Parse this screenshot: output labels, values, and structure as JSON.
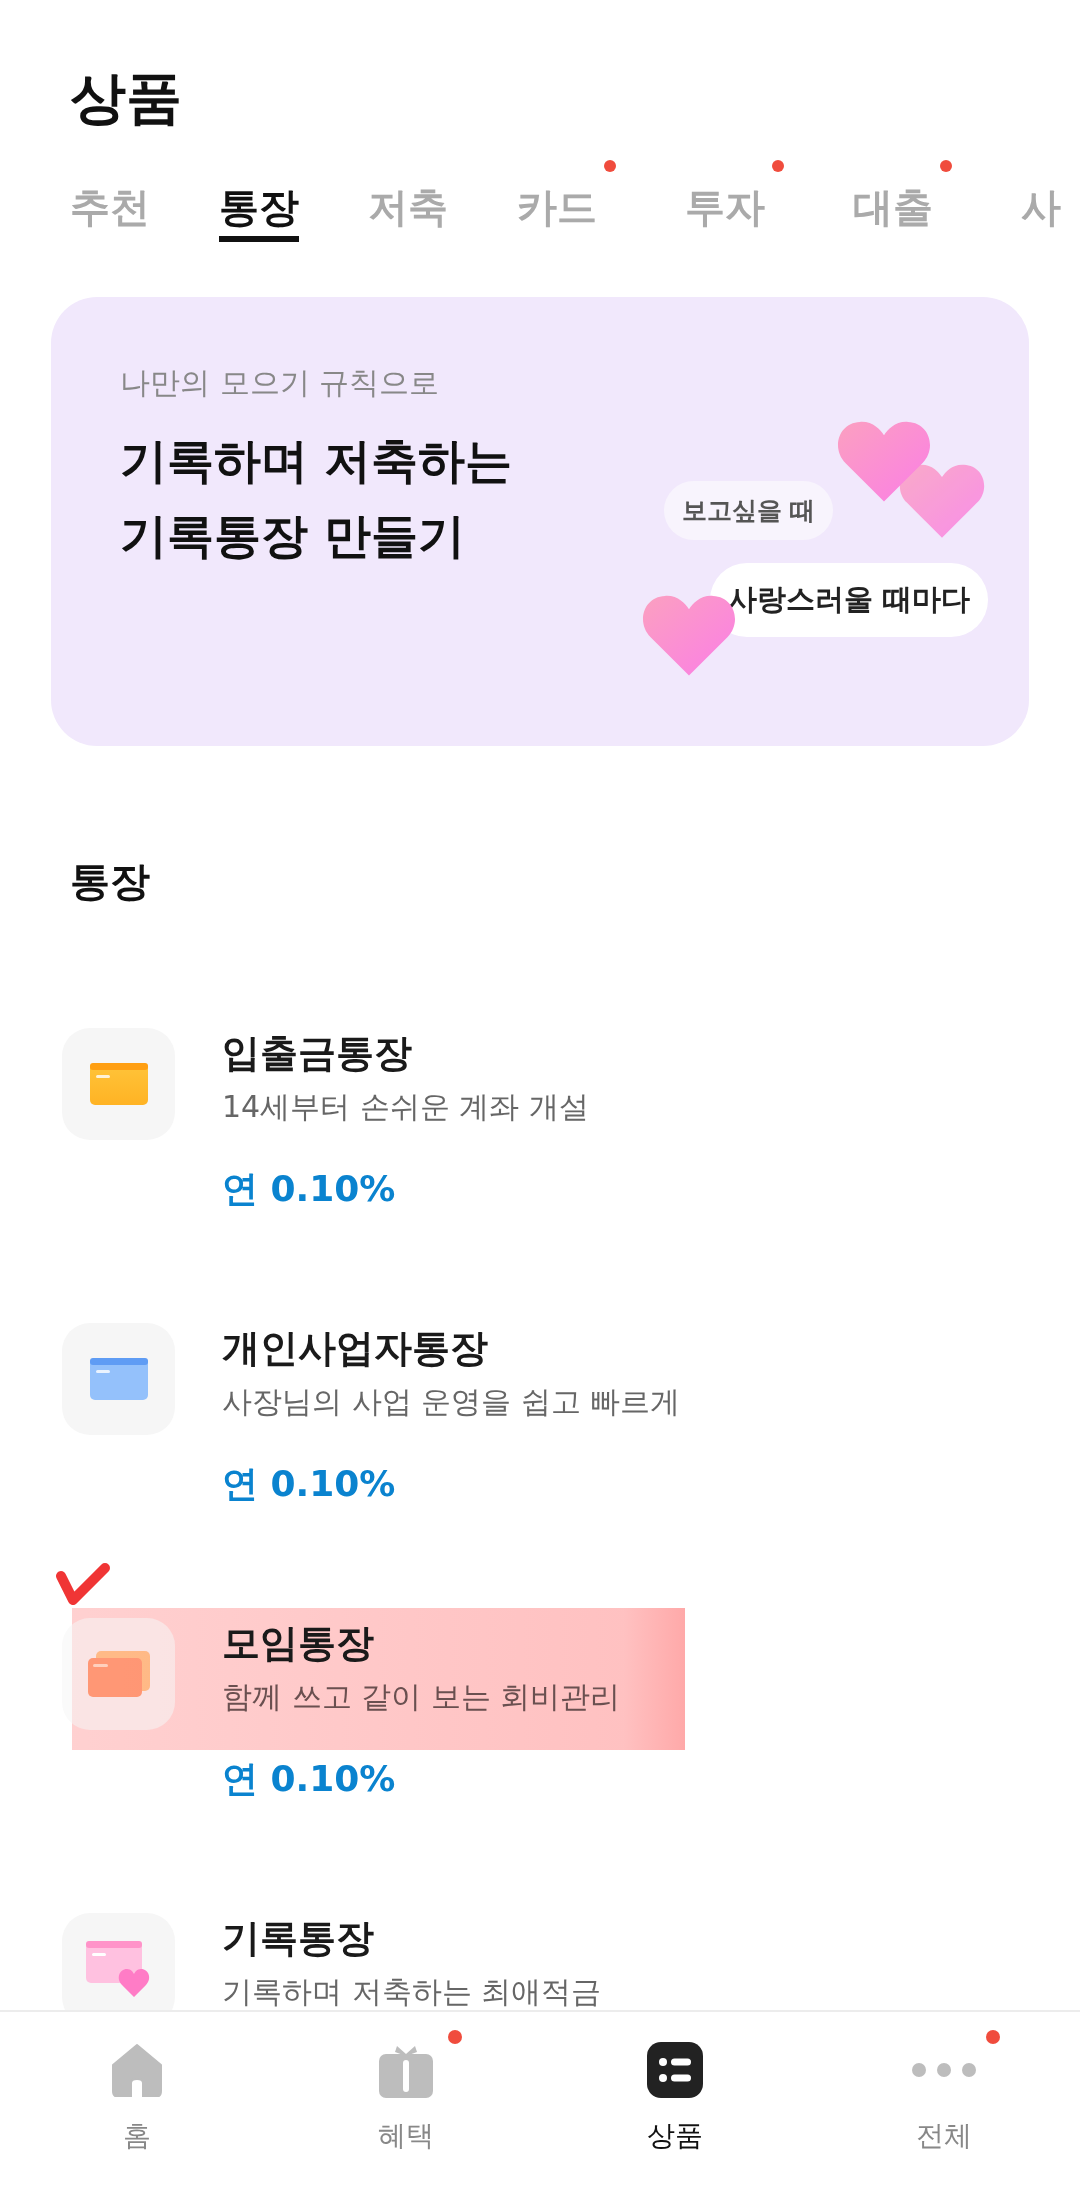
{
  "header": {
    "title": "상품"
  },
  "tabs": [
    {
      "label": "추천",
      "selected": false,
      "badge": false
    },
    {
      "label": "통장",
      "selected": true,
      "badge": false
    },
    {
      "label": "저축",
      "selected": false,
      "badge": false
    },
    {
      "label": "카드",
      "selected": false,
      "badge": true
    },
    {
      "label": "투자",
      "selected": false,
      "badge": true
    },
    {
      "label": "대출",
      "selected": false,
      "badge": true
    },
    {
      "label": "사",
      "selected": false,
      "badge": false
    }
  ],
  "banner": {
    "subtitle": "나만의 모으기 규칙으로",
    "title_lines": [
      "기록하며 저축하는",
      "기록통장 만들기"
    ],
    "bubbles": [
      "보고싶을 때",
      "사랑스러울 때마다"
    ]
  },
  "section": {
    "title": "통장"
  },
  "products": [
    {
      "kind": "basic",
      "name": "입출금통장",
      "description": "14세부터 손쉬운 계좌 개설",
      "rate": "연 0.10%",
      "highlighted": false
    },
    {
      "kind": "business",
      "name": "개인사업자통장",
      "description": "사장님의 사업 운영을 쉽고 빠르게",
      "rate": "연 0.10%",
      "highlighted": false
    },
    {
      "kind": "group",
      "name": "모임통장",
      "description": "함께 쓰고 같이 보는 회비관리",
      "rate": "연 0.10%",
      "highlighted": true
    },
    {
      "kind": "record",
      "name": "기록통장",
      "description": "기록하며 저축하는 최애적금",
      "highlighted": false
    }
  ],
  "bottom_nav": [
    {
      "kind": "home",
      "label": "홈",
      "selected": false,
      "badge": false
    },
    {
      "kind": "benefit",
      "label": "혜택",
      "selected": false,
      "badge": true
    },
    {
      "kind": "products",
      "label": "상품",
      "selected": true,
      "badge": false
    },
    {
      "kind": "more",
      "label": "전체",
      "selected": false,
      "badge": true
    }
  ]
}
